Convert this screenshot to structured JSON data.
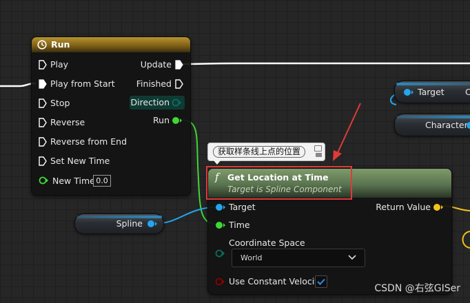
{
  "timeline_node": {
    "title": "Run",
    "exec_inputs": [
      "Play",
      "Play from Start",
      "Stop",
      "Reverse",
      "Reverse from End",
      "Set New Time"
    ],
    "new_time_label": "New Time",
    "new_time_value": "0.0",
    "outputs": {
      "update": "Update",
      "finished": "Finished",
      "direction": "Direction",
      "run": "Run"
    }
  },
  "comment_bubble": {
    "text": "获取样条线上点的位置"
  },
  "function_node": {
    "title": "Get Location at Time",
    "subtitle": "Target is Spline Component",
    "inputs": {
      "target": "Target",
      "time": "Time",
      "coordinate_space": "Coordinate Space",
      "use_constant_velocity": "Use Constant Velocity"
    },
    "coordinate_space_value": "World",
    "use_constant_velocity_checked": true,
    "outputs": {
      "return_value": "Return Value"
    },
    "function_icon": "f"
  },
  "variable_nodes": {
    "spline": "Spline",
    "target": "Target",
    "character": "Character"
  },
  "partial_label": "C",
  "watermark": "CSDN @右弦GISer",
  "colors": {
    "exec_wire": "#ffffff",
    "float_pin": "#3fd636",
    "object_pin": "#23a6f0",
    "vector_pin": "#f5c21a",
    "enum_pin": "#0a6e5e",
    "bool_pin": "#8a0000",
    "highlight_box": "#e03a3a",
    "timeline_header": "#8a6d1a",
    "function_header": "#6b8a5b"
  }
}
